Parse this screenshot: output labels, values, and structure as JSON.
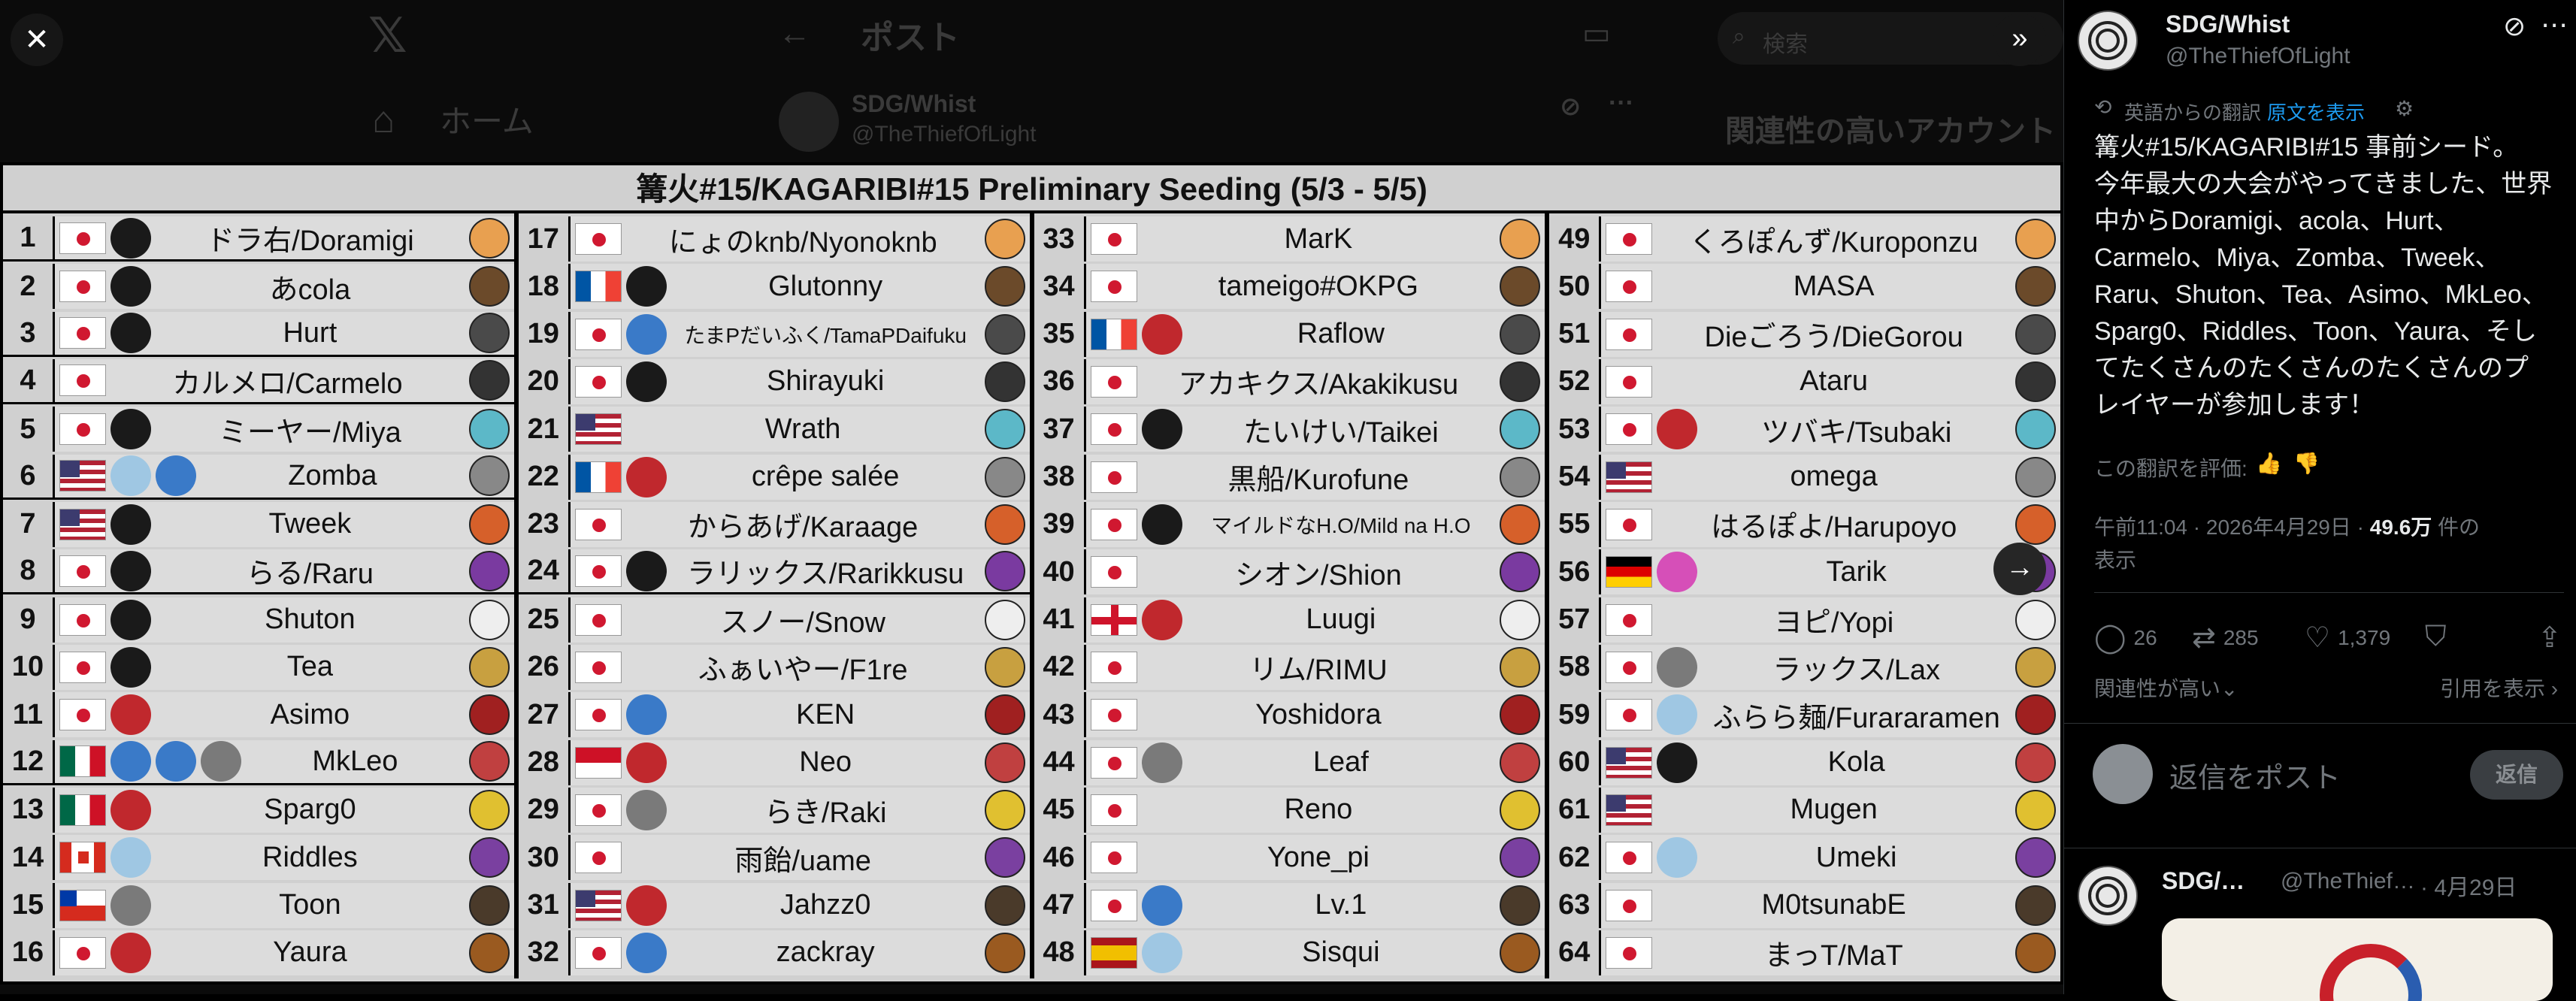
{
  "background": {
    "home_label": "ホーム",
    "post_title": "ポスト",
    "search_placeholder": "検索",
    "author_name": "SDG/Whist",
    "author_handle": "@TheThiefOfLight",
    "related_heading": "関連性の高いアカウント"
  },
  "seeding": {
    "title": "篝火#15/KAGARIBI#15 Preliminary Seeding (5/3 - 5/5)",
    "columns": [
      [
        {
          "n": "1",
          "flags": [
            "jp"
          ],
          "logos": [
            "dark"
          ],
          "name": "ドラ右/Doramigi"
        },
        {
          "n": "2",
          "flags": [
            "jp"
          ],
          "logos": [
            "dark"
          ],
          "name": "あcola"
        },
        {
          "n": "3",
          "flags": [
            "jp"
          ],
          "logos": [
            "dark"
          ],
          "name": "Hurt"
        },
        {
          "n": "4",
          "flags": [
            "jp"
          ],
          "logos": [],
          "name": "カルメロ/Carmelo"
        },
        {
          "n": "5",
          "flags": [
            "jp"
          ],
          "logos": [
            "dark"
          ],
          "name": "ミーヤー/Miya"
        },
        {
          "n": "6",
          "flags": [
            "us"
          ],
          "logos": [
            "light",
            "blue"
          ],
          "name": "Zomba"
        },
        {
          "n": "7",
          "flags": [
            "us"
          ],
          "logos": [
            "dark"
          ],
          "name": "Tweek"
        },
        {
          "n": "8",
          "flags": [
            "jp"
          ],
          "logos": [
            "dark"
          ],
          "name": "らる/Raru"
        },
        {
          "n": "9",
          "flags": [
            "jp"
          ],
          "logos": [
            "dark"
          ],
          "name": "Shuton"
        },
        {
          "n": "10",
          "flags": [
            "jp"
          ],
          "logos": [
            "dark"
          ],
          "name": "Tea"
        },
        {
          "n": "11",
          "flags": [
            "jp"
          ],
          "logos": [
            "red"
          ],
          "name": "Asimo"
        },
        {
          "n": "12",
          "flags": [
            "mx"
          ],
          "logos": [
            "blue",
            "blue",
            "gray"
          ],
          "name": "MkLeo"
        },
        {
          "n": "13",
          "flags": [
            "mx"
          ],
          "logos": [
            "red"
          ],
          "name": "Sparg0"
        },
        {
          "n": "14",
          "flags": [
            "ca"
          ],
          "logos": [
            "light"
          ],
          "name": "Riddles"
        },
        {
          "n": "15",
          "flags": [
            "cl"
          ],
          "logos": [
            "gray"
          ],
          "name": "Toon"
        },
        {
          "n": "16",
          "flags": [
            "jp"
          ],
          "logos": [
            "red"
          ],
          "name": "Yaura"
        }
      ],
      [
        {
          "n": "17",
          "flags": [
            "jp"
          ],
          "logos": [],
          "name": "にょのknb/Nyonoknb"
        },
        {
          "n": "18",
          "flags": [
            "fr"
          ],
          "logos": [
            "dark"
          ],
          "name": "Glutonny"
        },
        {
          "n": "19",
          "flags": [
            "jp"
          ],
          "logos": [
            "blue"
          ],
          "name": "たまPだいふく/TamaPDaifuku"
        },
        {
          "n": "20",
          "flags": [
            "jp"
          ],
          "logos": [
            "dark"
          ],
          "name": "Shirayuki"
        },
        {
          "n": "21",
          "flags": [
            "us"
          ],
          "logos": [],
          "name": "Wrath"
        },
        {
          "n": "22",
          "flags": [
            "fr"
          ],
          "logos": [
            "red"
          ],
          "name": "crêpe salée"
        },
        {
          "n": "23",
          "flags": [
            "jp"
          ],
          "logos": [],
          "name": "からあげ/Karaage"
        },
        {
          "n": "24",
          "flags": [
            "jp"
          ],
          "logos": [
            "dark"
          ],
          "name": "ラリックス/Rarikkusu"
        },
        {
          "n": "25",
          "flags": [
            "jp"
          ],
          "logos": [],
          "name": "スノー/Snow"
        },
        {
          "n": "26",
          "flags": [
            "jp"
          ],
          "logos": [],
          "name": "ふぁいやー/F1re"
        },
        {
          "n": "27",
          "flags": [
            "jp"
          ],
          "logos": [
            "blue"
          ],
          "name": "KEN"
        },
        {
          "n": "28",
          "flags": [
            "id"
          ],
          "logos": [
            "red"
          ],
          "name": "Neo"
        },
        {
          "n": "29",
          "flags": [
            "jp"
          ],
          "logos": [
            "gray"
          ],
          "name": "らき/Raki"
        },
        {
          "n": "30",
          "flags": [
            "jp"
          ],
          "logos": [],
          "name": "雨飴/uame"
        },
        {
          "n": "31",
          "flags": [
            "us"
          ],
          "logos": [
            "red"
          ],
          "name": "Jahzz0"
        },
        {
          "n": "32",
          "flags": [
            "jp"
          ],
          "logos": [
            "blue"
          ],
          "name": "zackray"
        }
      ],
      [
        {
          "n": "33",
          "flags": [
            "jp"
          ],
          "logos": [],
          "name": "MarK"
        },
        {
          "n": "34",
          "flags": [
            "jp"
          ],
          "logos": [],
          "name": "tameigo#OKPG"
        },
        {
          "n": "35",
          "flags": [
            "fr"
          ],
          "logos": [
            "red"
          ],
          "name": "Raflow"
        },
        {
          "n": "36",
          "flags": [
            "jp"
          ],
          "logos": [],
          "name": "アカキクス/Akakikusu"
        },
        {
          "n": "37",
          "flags": [
            "jp"
          ],
          "logos": [
            "dark"
          ],
          "name": "たいけい/Taikei"
        },
        {
          "n": "38",
          "flags": [
            "jp"
          ],
          "logos": [],
          "name": "黒船/Kurofune"
        },
        {
          "n": "39",
          "flags": [
            "jp"
          ],
          "logos": [
            "dark"
          ],
          "name": "マイルドなH.O/Mild na H.O"
        },
        {
          "n": "40",
          "flags": [
            "jp"
          ],
          "logos": [],
          "name": "シオン/Shion"
        },
        {
          "n": "41",
          "flags": [
            "en"
          ],
          "logos": [
            "red"
          ],
          "name": "Luugi"
        },
        {
          "n": "42",
          "flags": [
            "jp"
          ],
          "logos": [],
          "name": "リム/RIMU"
        },
        {
          "n": "43",
          "flags": [
            "jp"
          ],
          "logos": [],
          "name": "Yoshidora"
        },
        {
          "n": "44",
          "flags": [
            "jp"
          ],
          "logos": [
            "gray"
          ],
          "name": "Leaf"
        },
        {
          "n": "45",
          "flags": [
            "jp"
          ],
          "logos": [],
          "name": "Reno"
        },
        {
          "n": "46",
          "flags": [
            "jp"
          ],
          "logos": [],
          "name": "Yone_pi"
        },
        {
          "n": "47",
          "flags": [
            "jp"
          ],
          "logos": [
            "blue"
          ],
          "name": "Lv.1"
        },
        {
          "n": "48",
          "flags": [
            "es"
          ],
          "logos": [
            "light"
          ],
          "name": "Sisqui"
        }
      ],
      [
        {
          "n": "49",
          "flags": [
            "jp"
          ],
          "logos": [],
          "name": "くろぽんず/Kuroponzu"
        },
        {
          "n": "50",
          "flags": [
            "jp"
          ],
          "logos": [],
          "name": "MASA"
        },
        {
          "n": "51",
          "flags": [
            "jp"
          ],
          "logos": [],
          "name": "Dieごろう/DieGorou"
        },
        {
          "n": "52",
          "flags": [
            "jp"
          ],
          "logos": [],
          "name": "Ataru"
        },
        {
          "n": "53",
          "flags": [
            "jp"
          ],
          "logos": [
            "red"
          ],
          "name": "ツバキ/Tsubaki"
        },
        {
          "n": "54",
          "flags": [
            "us"
          ],
          "logos": [],
          "name": "omega"
        },
        {
          "n": "55",
          "flags": [
            "jp"
          ],
          "logos": [],
          "name": "はるぽよ/Harupoyo"
        },
        {
          "n": "56",
          "flags": [
            "de"
          ],
          "logos": [
            "pink"
          ],
          "name": "Tarik"
        },
        {
          "n": "57",
          "flags": [
            "jp"
          ],
          "logos": [],
          "name": "ヨピ/Yopi"
        },
        {
          "n": "58",
          "flags": [
            "jp"
          ],
          "logos": [
            "gray"
          ],
          "name": "ラックス/Lax"
        },
        {
          "n": "59",
          "flags": [
            "jp"
          ],
          "logos": [
            "light"
          ],
          "name": "ふらら麺/Furararamen"
        },
        {
          "n": "60",
          "flags": [
            "us"
          ],
          "logos": [
            "dark"
          ],
          "name": "Kola"
        },
        {
          "n": "61",
          "flags": [
            "us"
          ],
          "logos": [],
          "name": "Mugen"
        },
        {
          "n": "62",
          "flags": [
            "jp"
          ],
          "logos": [
            "light"
          ],
          "name": "Umeki"
        },
        {
          "n": "63",
          "flags": [
            "jp"
          ],
          "logos": [],
          "name": "M0tsunabE"
        },
        {
          "n": "64",
          "flags": [
            "jp"
          ],
          "logos": [],
          "name": "まっT/MaT"
        }
      ]
    ]
  },
  "panel": {
    "author_name": "SDG/Whist",
    "author_handle": "@TheThiefOfLight",
    "translated_from": "英語からの翻訳",
    "show_original": "原文を表示",
    "body": "篝火#15/KAGARIBI#15 事前シード。\n今年最大の大会がやってきました、世界中からDoramigi、acola、Hurt、Carmelo、Miya、Zomba、Tweek、Raru、Shuton、Tea、Asimo、MkLeo、Sparg0、Riddles、Toon、Yaura、そしてたくさんのたくさんのたくさんのプレイヤーが参加します！",
    "rate_translation": "この翻訳を評価:",
    "time": "午前11:04 · 2026年4月29日 · ",
    "views": "49.6万",
    "views_suffix": " 件の",
    "views_line2": "表示",
    "replies": "26",
    "reposts": "285",
    "likes": "1,379",
    "sort_label": "関連性が高い⌄",
    "quotes_label": "引用を表示 ›",
    "reply_placeholder": "返信をポスト",
    "reply_button": "返信",
    "next_post": {
      "author_name": "SDG/…",
      "author_handle": "@TheThief…",
      "time": "· 4月29日"
    }
  }
}
